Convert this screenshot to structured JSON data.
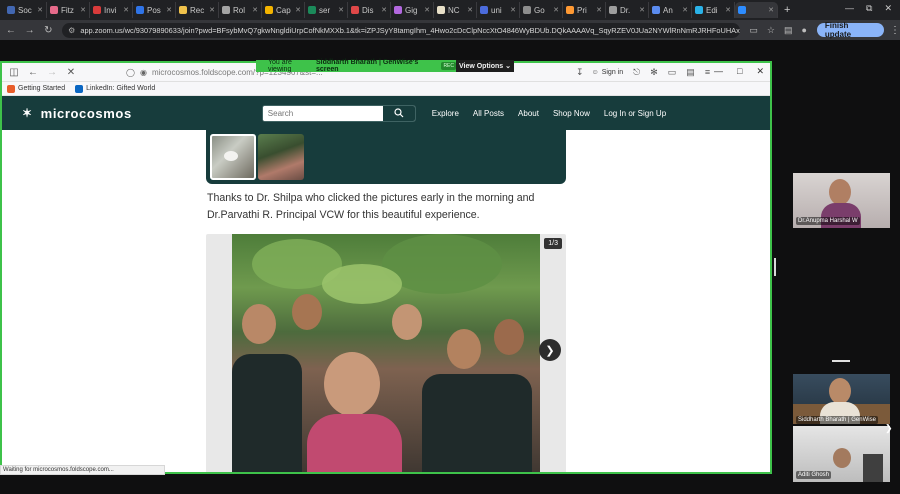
{
  "outer_browser": {
    "tabs": [
      {
        "label": "Soc",
        "color": "#4267b2"
      },
      {
        "label": "Fitz",
        "color": "#e66a8a"
      },
      {
        "label": "Invi",
        "color": "#d93b3b"
      },
      {
        "label": "Pos",
        "color": "#2f74e8"
      },
      {
        "label": "Rec",
        "color": "#f0c24b"
      },
      {
        "label": "Rol",
        "color": "#a3a3a3"
      },
      {
        "label": "Cap",
        "color": "#f4b400"
      },
      {
        "label": "ser",
        "color": "#1b8a5a"
      },
      {
        "label": "Dis",
        "color": "#e04848"
      },
      {
        "label": "Gig",
        "color": "#b368e0"
      },
      {
        "label": "NC",
        "color": "#e8e0c8"
      },
      {
        "label": "uni",
        "color": "#4b6bdc"
      },
      {
        "label": "Go",
        "color": "#8e8e8e"
      },
      {
        "label": "Pri",
        "color": "#ff9933"
      },
      {
        "label": "Dr.",
        "color": "#9e9e9e"
      },
      {
        "label": "An",
        "color": "#5b8cf0"
      },
      {
        "label": "Edi",
        "color": "#2ab2e8"
      },
      {
        "label": "",
        "color": "#2d8cff"
      }
    ],
    "address": "app.zoom.us/wc/93079890633/join?pwd=BFsybMvQ7gkwNngldiUrpCofNkMXXb.1&tk=iZPJSyY8tamgIhm_4Hwo2cDcClpNccXtO4846WyBDUb.DQkAAAAVq_SqyRZEV0JUa2NYWlRnNmRJRHFoUHAxUkNBAAAAAAAAAAAAAAA",
    "finish_update": "Finish update"
  },
  "banner": {
    "prefix": "You are viewing",
    "sharer": "Siddharth Bharath | GenWise's screen",
    "rec": "REC",
    "view_options": "View Options"
  },
  "inner_browser": {
    "url": "microcosmos.foldscope.com/?p=1234567&st=...",
    "sign_in": "Sign in",
    "bookmarks": [
      {
        "label": "Getting Started",
        "color": "#e85d2a"
      },
      {
        "label": "LinkedIn: Gifted World",
        "color": "#0a66c2"
      }
    ],
    "status_text": "Waiting for microcosmos.foldscope.com..."
  },
  "site": {
    "logo": "microcosmos",
    "search_placeholder": "Search",
    "nav": [
      "Explore",
      "All Posts",
      "About",
      "Shop Now",
      "Log In or Sign Up"
    ],
    "caption": "Thanks to Dr. Shilpa who clicked the pictures early in the morning and Dr.Parvathi R. Principal VCW for this beautiful experience.",
    "photo_counter": "1/3"
  },
  "participants": [
    {
      "name": "Dr.Anupma Harshal W"
    },
    {
      "name": "Siddharth Bharath | GenWise"
    },
    {
      "name": "Aditi Ghosh"
    }
  ]
}
